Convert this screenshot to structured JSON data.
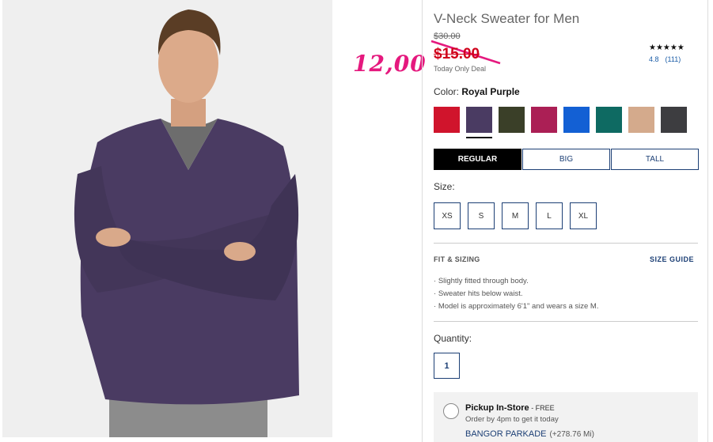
{
  "annotation": {
    "handwritten_price": "12,00",
    "color": "#e5197e"
  },
  "product": {
    "title": "V-Neck Sweater for Men",
    "original_price": "$30.00",
    "sale_price": "$15.00",
    "deal_text": "Today Only Deal",
    "rating_stars": "★★★★★",
    "rating_value": "4.8",
    "review_count": "(111)"
  },
  "color": {
    "label": "Color:",
    "selected_name": "Royal Purple",
    "swatches": [
      {
        "name": "red",
        "hex": "#d0142c"
      },
      {
        "name": "royal-purple",
        "hex": "#4a3b62",
        "selected": true
      },
      {
        "name": "olive",
        "hex": "#3a3f28"
      },
      {
        "name": "raspberry",
        "hex": "#ab1f55"
      },
      {
        "name": "blue",
        "hex": "#1360d4"
      },
      {
        "name": "teal",
        "hex": "#0e6a62"
      },
      {
        "name": "camel",
        "hex": "#d4aa8c"
      },
      {
        "name": "charcoal",
        "hex": "#3d3d40"
      }
    ]
  },
  "fit_tabs": [
    "REGULAR",
    "BIG",
    "TALL"
  ],
  "size": {
    "label": "Size:",
    "options": [
      "XS",
      "S",
      "M",
      "L",
      "XL"
    ]
  },
  "fit_sizing": {
    "heading": "FIT & SIZING",
    "guide_link": "SIZE GUIDE",
    "items": [
      "Slightly fitted through body.",
      "Sweater hits below waist.",
      "Model is approximately 6'1\" and wears a size M."
    ]
  },
  "quantity": {
    "label": "Quantity:",
    "value": "1"
  },
  "pickup": {
    "title": "Pickup In-Store",
    "free": " - FREE",
    "subtitle": "Order by 4pm to get it today",
    "store": "BANGOR PARKADE",
    "distance": "(+278.76 Mi)"
  }
}
